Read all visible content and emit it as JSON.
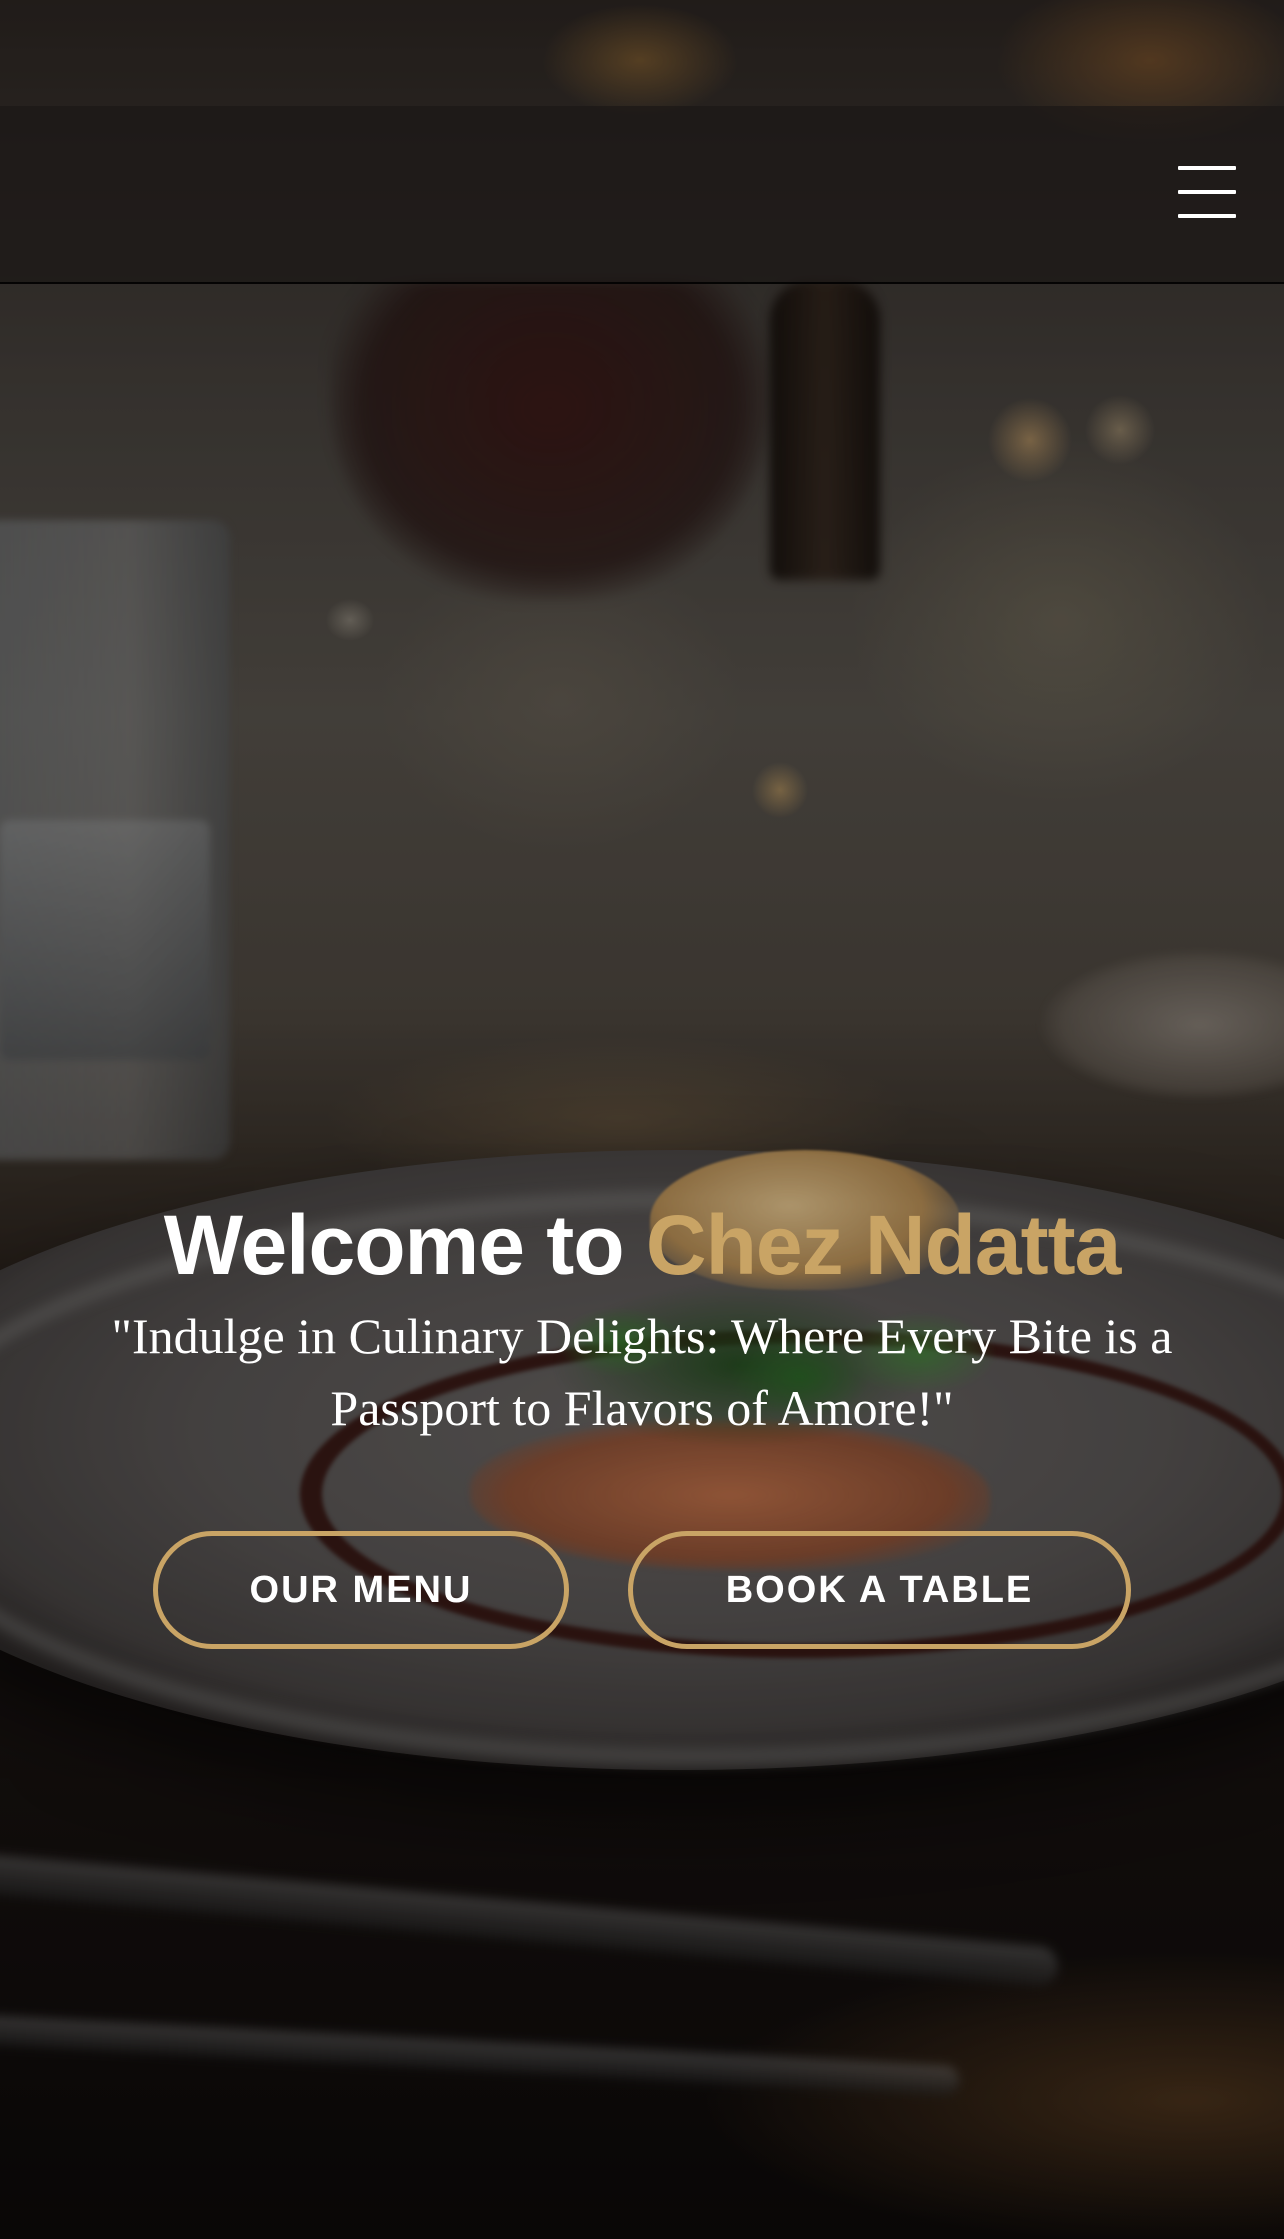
{
  "header": {
    "menu_icon": "hamburger-menu-icon"
  },
  "hero": {
    "title_prefix": "Welcome to ",
    "title_brand": "Chez Ndatta",
    "tagline": "\"Indulge in Culinary Delights: Where Every Bite is a Passport to Flavors of Amore!\""
  },
  "buttons": {
    "menu_label": "OUR MENU",
    "book_label": "BOOK A TABLE"
  },
  "colors": {
    "accent": "#c9a465",
    "text": "#ffffff",
    "header_bg": "rgba(28,24,22,0.72)"
  }
}
